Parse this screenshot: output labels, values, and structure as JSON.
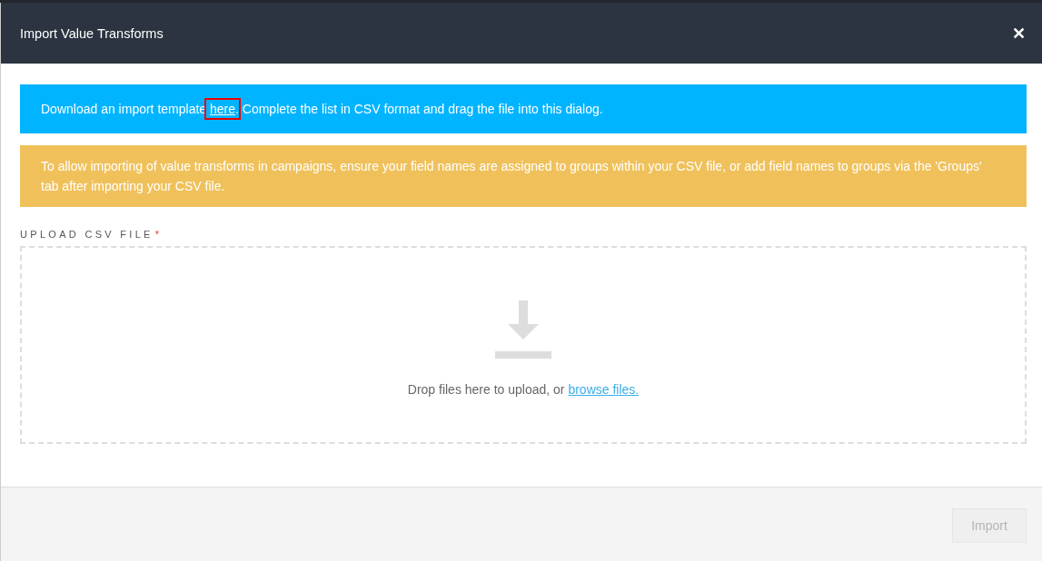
{
  "dialog": {
    "title": "Import Value Transforms",
    "close": "✕"
  },
  "info_banner": {
    "before": "Download an import template ",
    "link": {
      "label": "here",
      "highlighted": true
    },
    "after": ". Complete the list in CSV format and drag the file into this dialog."
  },
  "warning_banner": {
    "text": "To allow importing of value transforms in campaigns, ensure your field names are assigned to groups within your CSV file, or add field names to groups via the 'Groups' tab after importing your CSV file."
  },
  "upload": {
    "label": "UPLOAD CSV FILE",
    "required": true,
    "required_mark": "*",
    "hint": "Drop files here to upload, or ",
    "link": "browse files."
  },
  "buttons": [
    {
      "label": "Import",
      "disabled": true
    }
  ]
}
